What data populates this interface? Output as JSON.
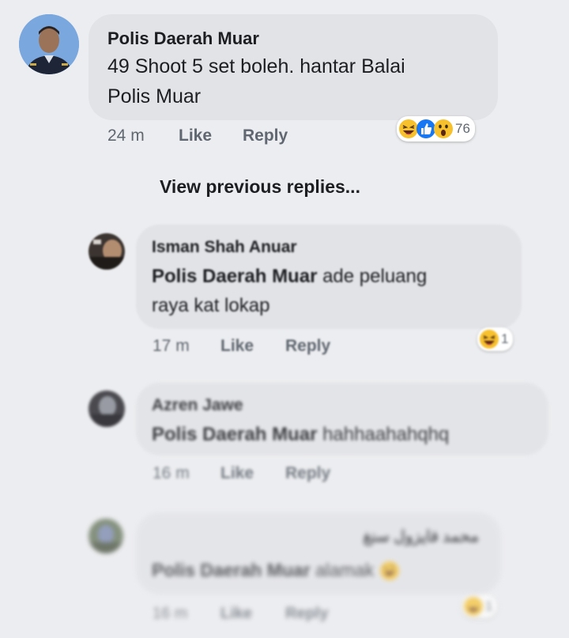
{
  "comments": [
    {
      "author": "Polis Daerah Muar",
      "line1": "49 Shoot 5 set boleh. hantar Balai",
      "line2": "Polis Muar",
      "time": "24 m",
      "like": "Like",
      "reply": "Reply",
      "reaction_count": "76",
      "reactions": [
        "laugh-emoji",
        "thumbs-up-emoji",
        "wow-emoji"
      ]
    }
  ],
  "view_previous": "View previous replies...",
  "replies": [
    {
      "author": "Isman Shah Anuar",
      "mention": "Polis Daerah Muar",
      "text_after_mention": " ade peluang",
      "line2": "raya kat lokap",
      "time": "17 m",
      "like": "Like",
      "reply": "Reply",
      "reaction_count": "1",
      "reactions": [
        "laugh-emoji"
      ]
    },
    {
      "author": "Azren Jawe",
      "mention": "Polis Daerah Muar",
      "text_after_mention": " hahhaahahqhq",
      "time": "16 m",
      "like": "Like",
      "reply": "Reply"
    },
    {
      "author": "محمد فايزول سنغ",
      "mention": "Polis Daerah Muar",
      "text_after_mention": " alamak",
      "inline_emoji": "rofl-emoji",
      "time": "16 m",
      "like": "Like",
      "reply": "Reply",
      "reaction_count": "1",
      "reactions": [
        "laugh-emoji"
      ]
    }
  ],
  "colors": {
    "background": "#ecedf0",
    "bubble": "#e2e3e7",
    "meta_text": "#606770",
    "like_blue": "#1877f2",
    "emoji_yellow": "#f7c12e"
  }
}
